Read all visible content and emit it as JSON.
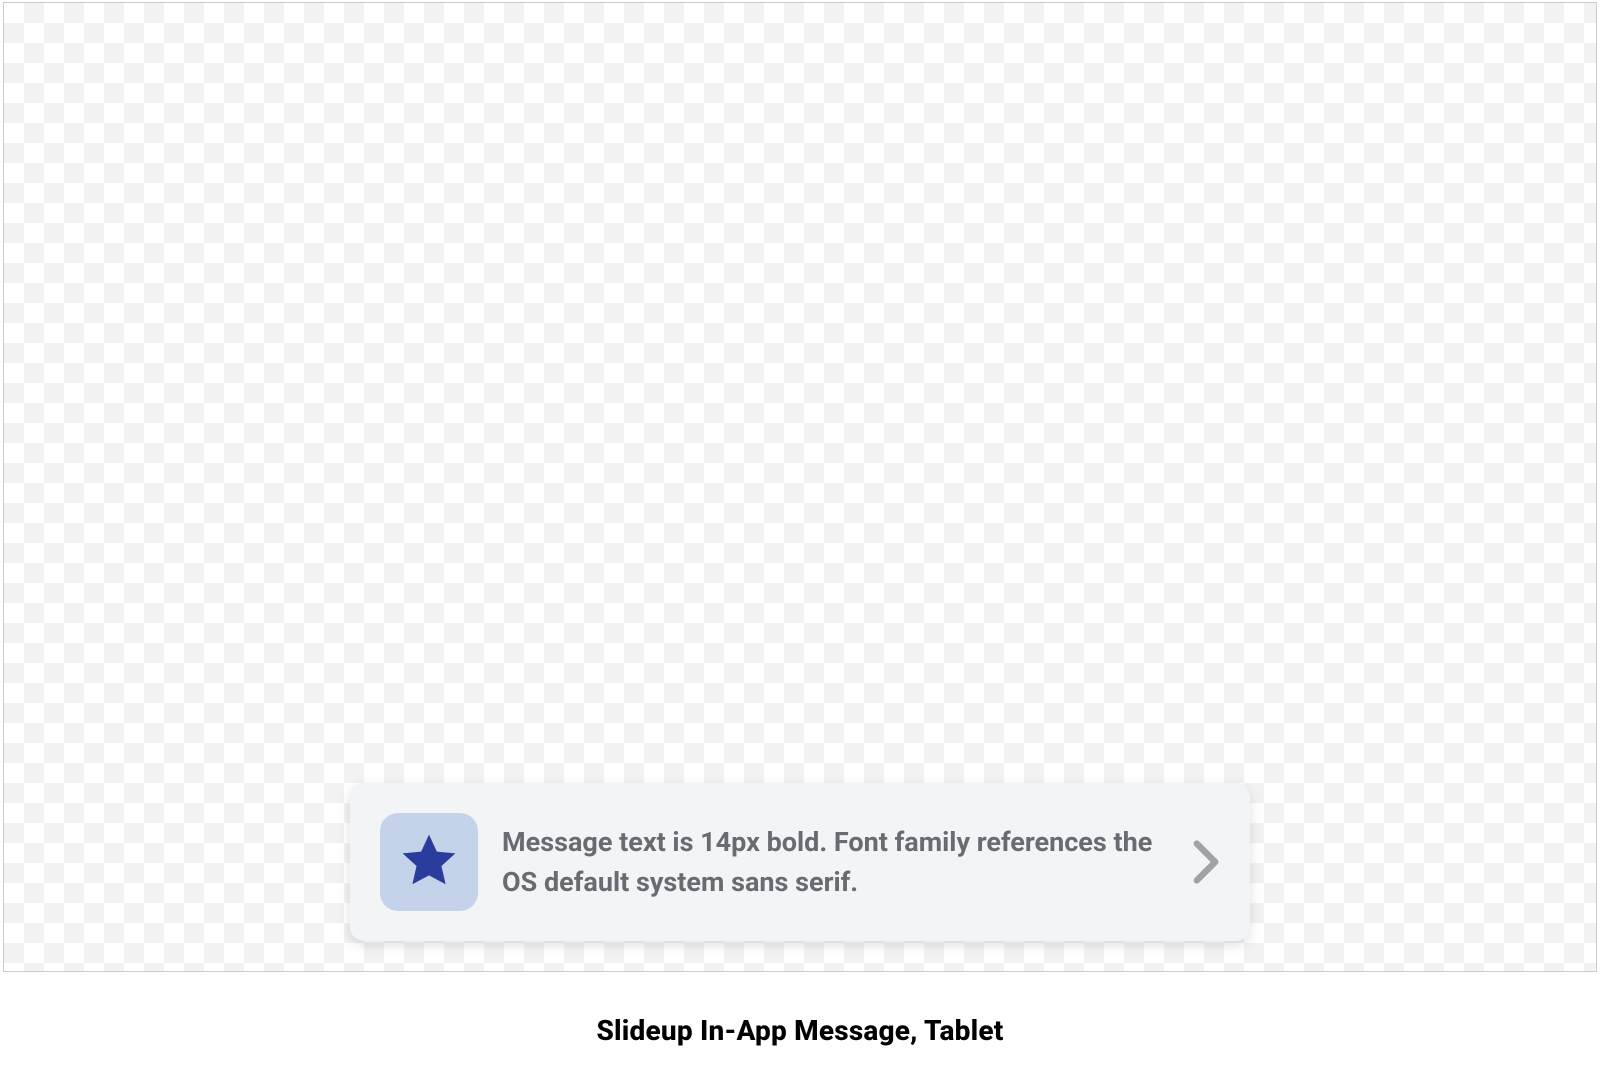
{
  "message": {
    "text": "Message text is 14px bold. Font family references the OS default system sans serif."
  },
  "caption": "Slideup In-App Message, Tablet",
  "colors": {
    "icon_badge_bg": "#c4d3ea",
    "star_fill": "#2b3d9c",
    "message_bg": "#f3f4f6",
    "text_color": "#686b71",
    "chevron_color": "#a0a2a8"
  }
}
